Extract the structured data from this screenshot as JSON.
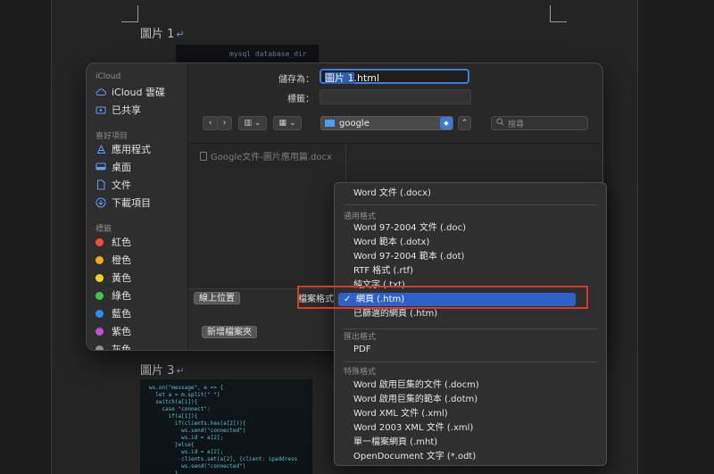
{
  "document": {
    "caption_1": "圖片 1",
    "caption_3": "圖片 3",
    "return_mark": "↵",
    "image_top_text": "mysql  database_dir",
    "code_lines": [
      "ws.on(\"message\", e => {",
      "  let a = m.split(\" \")",
      "  switch(a[1]){",
      "    case \"connect\":",
      "      if(a[1]){",
      "        if(clients.has(a[2])){",
      "          ws.send(\"connected\")",
      "          ws.id = a[2];",
      "        }else{",
      "          ws.id = a[2];",
      "          clients.set(a[2], {client: ipaddress",
      "          ws.send(\"connected\")",
      "        }"
    ]
  },
  "dialog": {
    "save_as_label": "儲存為：",
    "save_as_value_selected": "圖片 1",
    "save_as_value_rest": ".html",
    "tags_label": "標籤：",
    "location": "google",
    "search_placeholder": "搜尋",
    "file_entry": "Google文件-圖片應用篇.docx",
    "online_location_button": "線上位置",
    "format_label": "檔案格式",
    "new_folder_button": "新增檔案夾",
    "icons": {
      "back": "chevron-left-icon",
      "forward": "chevron-right-icon",
      "view": "column-view-icon",
      "group": "grid-icon",
      "search": "magnifier-icon"
    }
  },
  "sidebar": {
    "icloud_header": "iCloud",
    "icloud_drive": "iCloud 雲碟",
    "shared": "已共享",
    "favorites_header": "喜好項目",
    "applications": "應用程式",
    "desktop": "桌面",
    "documents": "文件",
    "downloads": "下載項目",
    "tags_header": "標籤",
    "tags": [
      {
        "label": "紅色",
        "color": "#f04e45"
      },
      {
        "label": "橙色",
        "color": "#f5a623"
      },
      {
        "label": "黃色",
        "color": "#f7d21a"
      },
      {
        "label": "綠色",
        "color": "#3fc64a"
      },
      {
        "label": "藍色",
        "color": "#2f8cf2"
      },
      {
        "label": "紫色",
        "color": "#c052d6"
      },
      {
        "label": "灰色",
        "color": "#8e8e93"
      }
    ]
  },
  "format_menu": {
    "top_item": "Word 文件 (.docx)",
    "common_header": "通用格式",
    "common": [
      "Word 97-2004 文件 (.doc)",
      "Word 範本 (.dotx)",
      "Word 97-2004 範本 (.dot)",
      "RTF 格式 (.rtf)",
      "純文字 (.txt)",
      "網頁 (.htm)",
      "已篩選的網頁 (.htm)"
    ],
    "selected_index": 5,
    "check_mark": "✓",
    "export_header": "匯出格式",
    "export": [
      "PDF"
    ],
    "special_header": "特殊格式",
    "special": [
      "Word 啟用巨集的文件 (.docm)",
      "Word 啟用巨集的範本 (.dotm)",
      "Word XML 文件 (.xml)",
      "Word 2003 XML 文件 (.xml)",
      "單一檔案網頁 (.mht)",
      "OpenDocument 文字 (*.odt)"
    ]
  },
  "colors": {
    "accent": "#2f62c8",
    "highlight_box": "#d83a2e"
  }
}
